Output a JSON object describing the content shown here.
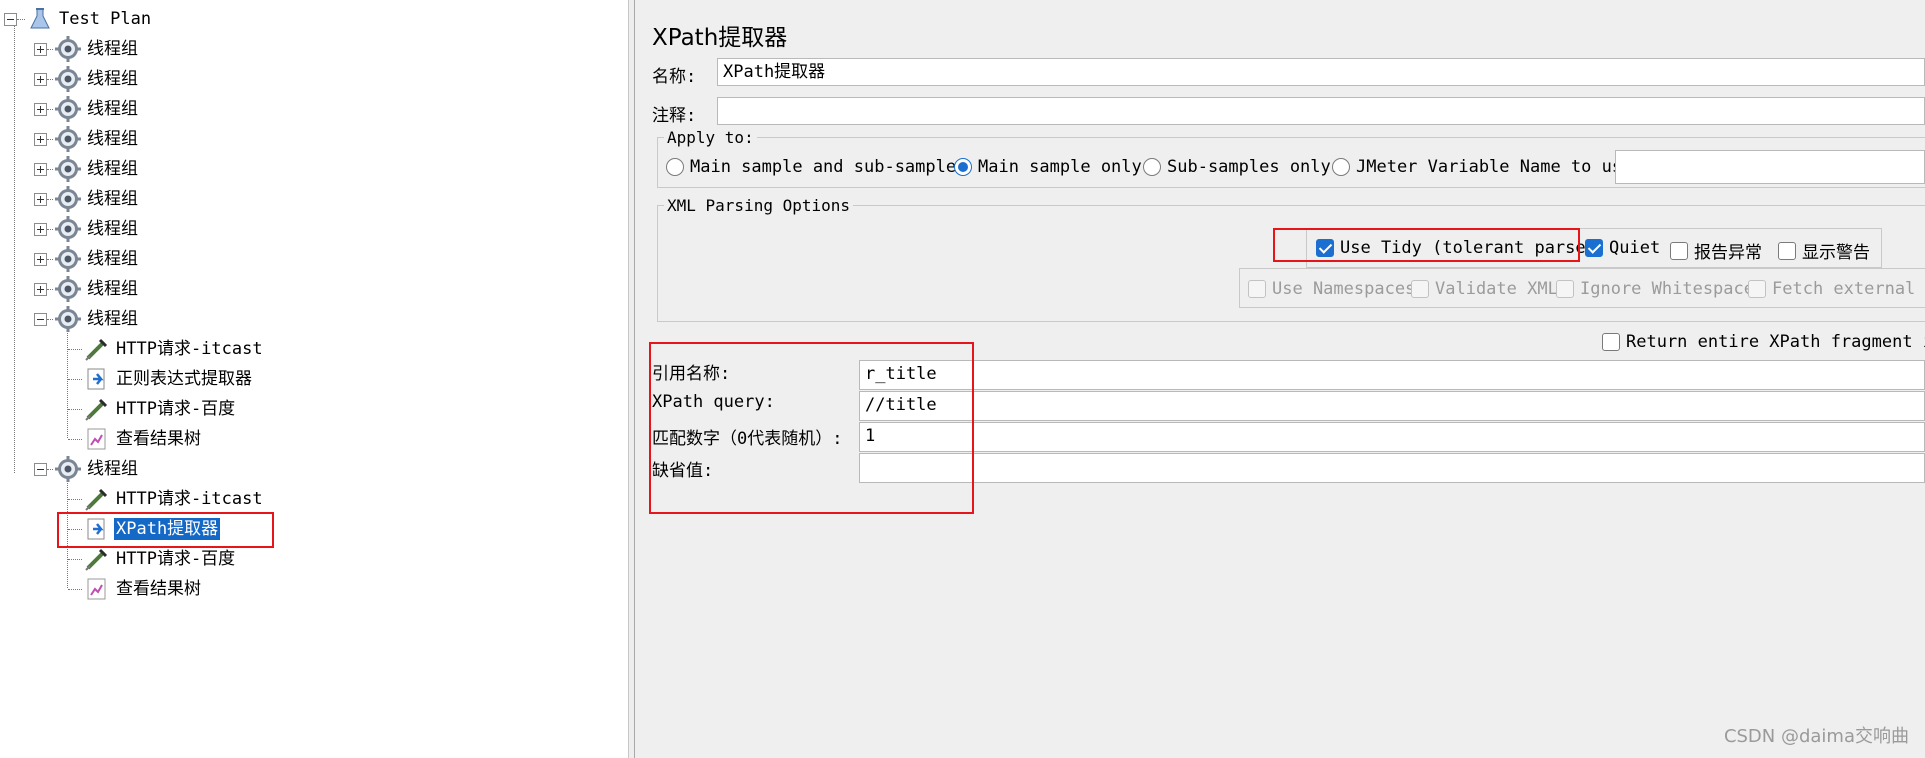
{
  "tree": {
    "root": "Test Plan",
    "items": [
      {
        "label": "线程组",
        "kind": "thread-group",
        "expanded": false
      },
      {
        "label": "线程组",
        "kind": "thread-group",
        "expanded": false
      },
      {
        "label": "线程组",
        "kind": "thread-group",
        "expanded": false
      },
      {
        "label": "线程组",
        "kind": "thread-group",
        "expanded": false
      },
      {
        "label": "线程组",
        "kind": "thread-group",
        "expanded": false
      },
      {
        "label": "线程组",
        "kind": "thread-group",
        "expanded": false
      },
      {
        "label": "线程组",
        "kind": "thread-group",
        "expanded": false
      },
      {
        "label": "线程组",
        "kind": "thread-group",
        "expanded": false
      },
      {
        "label": "线程组",
        "kind": "thread-group",
        "expanded": false
      },
      {
        "label": "线程组",
        "kind": "thread-group",
        "expanded": true
      },
      {
        "label": "HTTP请求-itcast",
        "kind": "sampler"
      },
      {
        "label": "正则表达式提取器",
        "kind": "extractor"
      },
      {
        "label": "HTTP请求-百度",
        "kind": "sampler"
      },
      {
        "label": "查看结果树",
        "kind": "listener"
      },
      {
        "label": "线程组",
        "kind": "thread-group",
        "expanded": true
      },
      {
        "label": "HTTP请求-itcast",
        "kind": "sampler"
      },
      {
        "label": "XPath提取器",
        "kind": "extractor",
        "selected": true
      },
      {
        "label": "HTTP请求-百度",
        "kind": "sampler"
      },
      {
        "label": "查看结果树",
        "kind": "listener"
      }
    ]
  },
  "panel": {
    "title": "XPath提取器",
    "name_label": "名称:",
    "name_value": "XPath提取器",
    "comment_label": "注释:",
    "comment_value": "",
    "apply_to": {
      "legend": "Apply to:",
      "options": [
        {
          "label": "Main sample and sub-samples",
          "selected": false
        },
        {
          "label": "Main sample only",
          "selected": true
        },
        {
          "label": "Sub-samples only",
          "selected": false
        },
        {
          "label": "JMeter Variable Name to use",
          "selected": false
        }
      ],
      "variable_value": ""
    },
    "xml_options": {
      "legend": "XML Parsing Options",
      "tidy": {
        "label": "Use Tidy (tolerant parser)",
        "checked": true
      },
      "quiet": {
        "label": "Quiet",
        "checked": true
      },
      "report_errors": {
        "label": "报告异常",
        "checked": false
      },
      "show_warnings": {
        "label": "显示警告",
        "checked": false
      },
      "use_namespaces": {
        "label": "Use Namespaces",
        "checked": false
      },
      "validate_xml": {
        "label": "Validate XML",
        "checked": false
      },
      "ignore_whitespace": {
        "label": "Ignore Whitespace",
        "checked": false
      },
      "fetch_external": {
        "label": "Fetch external DT",
        "checked": false
      }
    },
    "return_fragment": {
      "label": "Return entire XPath fragment inst",
      "checked": false
    },
    "fields": {
      "ref_name_label": "引用名称:",
      "ref_name_value": "r_title",
      "xpath_label": "XPath query:",
      "xpath_value": "//title",
      "match_no_label": "匹配数字（0代表随机）:",
      "match_no_value": "1",
      "default_label": "缺省值:",
      "default_value": ""
    }
  },
  "watermark": "CSDN @daima交响曲"
}
